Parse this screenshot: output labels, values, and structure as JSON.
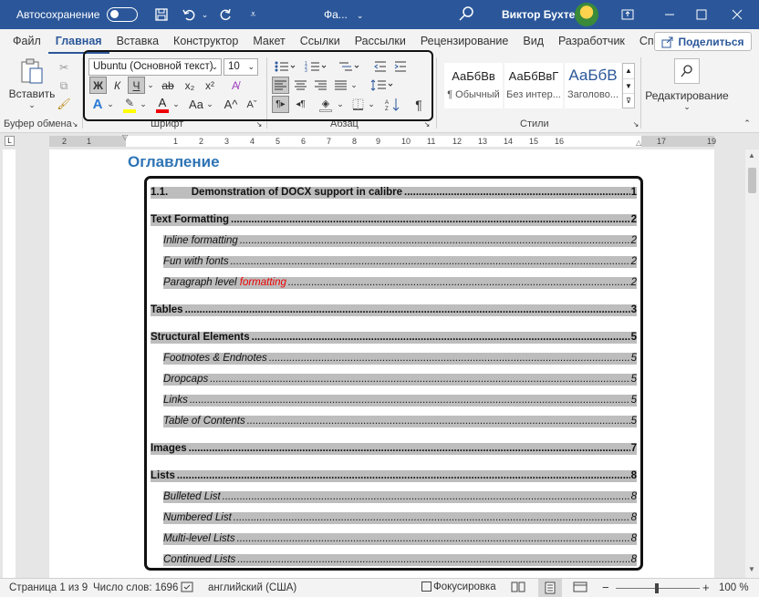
{
  "titlebar": {
    "autosave_label": "Автосохранение",
    "doc_name": "Фа...",
    "user_name": "Виктор Бухтеев"
  },
  "tabs": [
    {
      "label": "Файл"
    },
    {
      "label": "Главная"
    },
    {
      "label": "Вставка"
    },
    {
      "label": "Конструктор"
    },
    {
      "label": "Макет"
    },
    {
      "label": "Ссылки"
    },
    {
      "label": "Рассылки"
    },
    {
      "label": "Рецензирование"
    },
    {
      "label": "Вид"
    },
    {
      "label": "Разработчик"
    },
    {
      "label": "Справка"
    }
  ],
  "share_label": "Поделиться",
  "ribbon": {
    "paste_label": "Вставить",
    "clipboard_group": "Буфер обмена",
    "font_group": "Шрифт",
    "paragraph_group": "Абзац",
    "styles_group": "Стили",
    "font_name": "Ubuntu (Основной текст)",
    "font_size": "10",
    "bold_glyph": "Ж",
    "italic_glyph": "К",
    "underline_glyph": "Ч",
    "strike_glyph": "ab",
    "sub_glyph": "x₂",
    "sup_glyph": "x²",
    "case_glyph": "Aa",
    "grow_glyph": "A^",
    "shrink_glyph": "Aˇ",
    "styles": [
      {
        "preview": "АаБбВв",
        "name": "¶ Обычный"
      },
      {
        "preview": "АаБбВвГ",
        "name": "Без интер..."
      },
      {
        "preview": "АаБбВ",
        "name": "Заголово..."
      }
    ],
    "editing_label": "Редактирование"
  },
  "ruler_numbers": [
    "2",
    "1",
    "1",
    "2",
    "3",
    "4",
    "5",
    "6",
    "7",
    "8",
    "9",
    "10",
    "11",
    "12",
    "13",
    "14",
    "15",
    "16",
    "17",
    "19"
  ],
  "document": {
    "title": "Оглавление",
    "toc": [
      {
        "text": "1.1.        Demonstration of DOCX support in calibre",
        "page": "1",
        "level": 1
      },
      {
        "text": "Text Formatting",
        "page": "2",
        "level": 1
      },
      {
        "text": "Inline formatting",
        "page": "2",
        "level": 2
      },
      {
        "text": "Fun with fonts",
        "page": "2",
        "level": 2
      },
      {
        "text": "Paragraph level ",
        "text_red": "formatting",
        "page": "2",
        "level": 2
      },
      {
        "text": "Tables",
        "page": "3",
        "level": 1
      },
      {
        "text": "Structural Elements",
        "page": "5",
        "level": 1
      },
      {
        "text": "Footnotes & Endnotes",
        "page": "5",
        "level": 2
      },
      {
        "text": "Dropcaps",
        "page": "5",
        "level": 2
      },
      {
        "text": "Links",
        "page": "5",
        "level": 2
      },
      {
        "text": "Table of Contents",
        "page": "5",
        "level": 2
      },
      {
        "text": "Images",
        "page": "7",
        "level": 1
      },
      {
        "text": "Lists",
        "page": "8",
        "level": 1
      },
      {
        "text": "Bulleted List",
        "page": "8",
        "level": 2
      },
      {
        "text": "Numbered List",
        "page": "8",
        "level": 2
      },
      {
        "text": "Multi-level Lists",
        "page": "8",
        "level": 2
      },
      {
        "text": "Continued Lists",
        "page": "8",
        "level": 2
      }
    ]
  },
  "statusbar": {
    "page_info": "Страница 1 из 9",
    "word_count": "Число слов: 1696",
    "language": "английский (США)",
    "focus_label": "Фокусировка",
    "zoom": "100 %"
  },
  "colors": {
    "titlebar": "#2b579a",
    "heading": "#2e74b5",
    "toc_highlight": "#bdbdbd",
    "red_text": "#e00000"
  }
}
